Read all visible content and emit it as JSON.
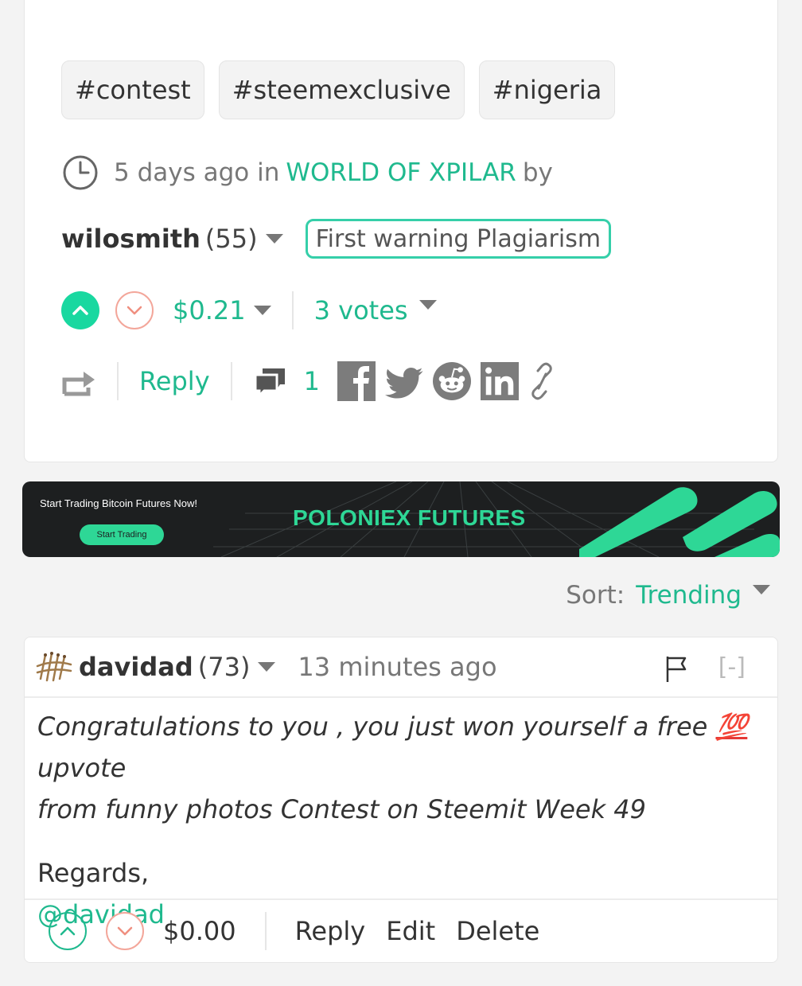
{
  "post": {
    "tags": [
      "#contest",
      "#steemexclusive",
      "#nigeria"
    ],
    "meta_time": "5 days ago in",
    "community": "WORLD OF XPILAR",
    "by": "by",
    "author": "wilosmith",
    "author_rep": "(55)",
    "warning_label": "First warning Plagiarism",
    "payout": "$0.21",
    "votes": "3 votes",
    "reply_label": "Reply",
    "comment_count": "1",
    "social_icons": [
      "facebook-icon",
      "twitter-icon",
      "reddit-icon",
      "linkedin-icon",
      "link-icon"
    ]
  },
  "banner": {
    "tagline": "Start Trading Bitcoin Futures Now!",
    "button_label": "Start Trading",
    "brand": "POLONIEX FUTURES"
  },
  "sort": {
    "label": "Sort:",
    "value": "Trending"
  },
  "comment": {
    "author": "davidad",
    "author_rep": "(73)",
    "time": "13 minutes ago",
    "collapse_label": "[-]",
    "body_line_1": "Congratulations to you , you just won yourself a free",
    "emoji_100": "💯",
    "body_line_1b": "upvote",
    "body_line_2": "from funny photos Contest on Steemit Week 49",
    "regards": "Regards,",
    "mention": "@davidad",
    "payout": "$0.00",
    "actions": {
      "reply": "Reply",
      "edit": "Edit",
      "delete": "Delete"
    }
  },
  "colors": {
    "accent": "#1fb98e",
    "upvote_fill": "#19d8a0",
    "downvote_border": "#f3a69a",
    "badge_border": "#35cfa9",
    "banner_bg": "#1d1f20",
    "banner_green": "#2ed796"
  }
}
